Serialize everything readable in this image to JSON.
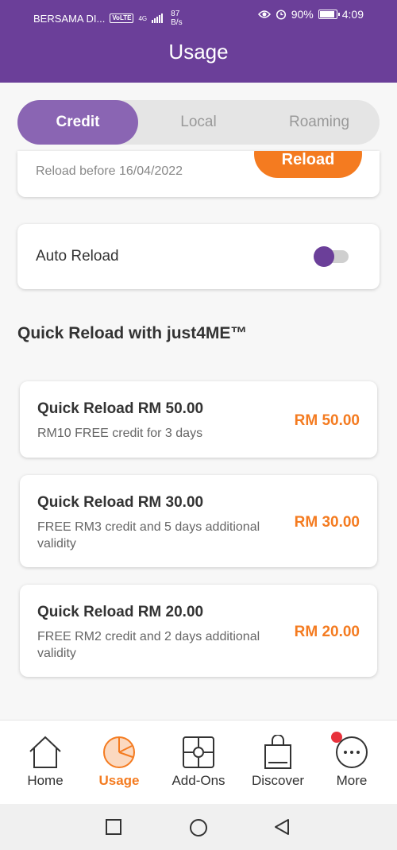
{
  "status_bar": {
    "carrier": "BERSAMA DI...",
    "volte": "VoLTE",
    "network": "4G",
    "speed_value": "87",
    "speed_unit": "B/s",
    "battery": "90%",
    "battery_level": 0.9,
    "time": "4:09"
  },
  "header": {
    "title": "Usage"
  },
  "tabs": [
    {
      "label": "Credit",
      "active": true
    },
    {
      "label": "Local",
      "active": false
    },
    {
      "label": "Roaming",
      "active": false
    }
  ],
  "reload_card": {
    "before_text": "Reload before 16/04/2022",
    "button_label": "Reload"
  },
  "auto_reload": {
    "label": "Auto Reload",
    "enabled": false
  },
  "section": {
    "title": "Quick Reload with just4ME™"
  },
  "offers": [
    {
      "title": "Quick Reload RM 50.00",
      "description": "RM10 FREE credit for 3 days",
      "price": "RM 50.00"
    },
    {
      "title": "Quick Reload RM 30.00",
      "description": "FREE RM3 credit and 5 days additional validity",
      "price": "RM 30.00"
    },
    {
      "title": "Quick Reload RM 20.00",
      "description": "FREE RM2 credit and 2 days additional validity",
      "price": "RM 20.00"
    }
  ],
  "bottom_nav": [
    {
      "label": "Home",
      "icon": "home-icon",
      "active": false
    },
    {
      "label": "Usage",
      "icon": "pie-chart-icon",
      "active": true
    },
    {
      "label": "Add-Ons",
      "icon": "puzzle-icon",
      "active": false
    },
    {
      "label": "Discover",
      "icon": "shopping-bag-icon",
      "active": false
    },
    {
      "label": "More",
      "icon": "more-dots-icon",
      "active": false,
      "notification": true
    }
  ],
  "colors": {
    "header": "#6b3f99",
    "accent_orange": "#f47b20",
    "active_tab": "#8a65b3",
    "notification": "#e8323c"
  }
}
